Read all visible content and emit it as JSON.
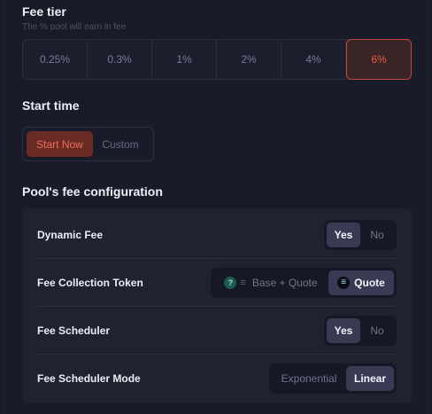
{
  "fee_tier": {
    "title": "Fee tier",
    "subtitle": "The % pool will earn in fee",
    "options": [
      "0.25%",
      "0.3%",
      "1%",
      "2%",
      "4%",
      "6%"
    ],
    "selected": "6%"
  },
  "start_time": {
    "title": "Start time",
    "options": [
      "Start Now",
      "Custom"
    ],
    "selected": "Start Now"
  },
  "fee_config": {
    "title": "Pool's fee configuration",
    "dynamic_fee": {
      "label": "Dynamic Fee",
      "options": [
        "Yes",
        "No"
      ],
      "selected": "Yes"
    },
    "fee_collection_token": {
      "label": "Fee Collection Token",
      "options": [
        "Base + Quote",
        "Quote"
      ],
      "selected": "Quote",
      "base_icon": "question-token-icon",
      "quote_icon": "solana-icon"
    },
    "fee_scheduler": {
      "label": "Fee Scheduler",
      "options": [
        "Yes",
        "No"
      ],
      "selected": "Yes"
    },
    "fee_scheduler_mode": {
      "label": "Fee Scheduler Mode",
      "options": [
        "Exponential",
        "Linear"
      ],
      "selected": "Linear"
    }
  },
  "colors": {
    "background": "#191b29",
    "accent": "#ea5b44",
    "card": "#202231",
    "toggle_active": "#393b55"
  }
}
